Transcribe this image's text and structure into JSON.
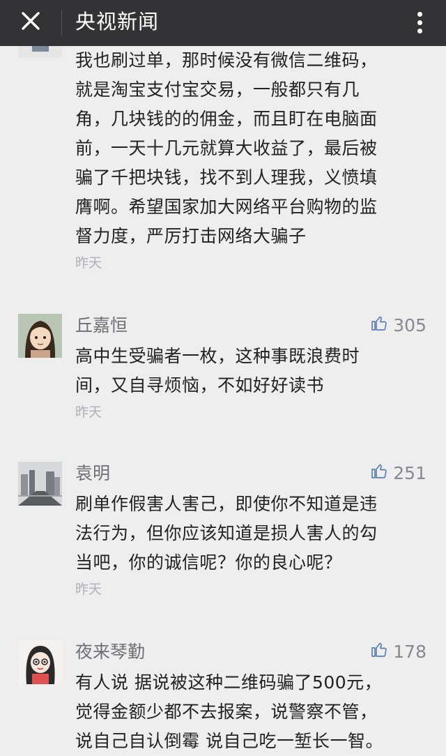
{
  "header": {
    "title": "央视新闻"
  },
  "comments": [
    {
      "username": "",
      "likes": "",
      "lines": [
        "我也刷过单，那时候没有微信二维码，",
        "就是淘宝支付宝交易，一般都只有几",
        "角，几块钱的的佣金，而且盯在电脑面",
        "前，一天十几元就算大收益了，最后被",
        "骗了千把块钱，找不到人理我，义愤填",
        "膺啊。希望国家加大网络平台购物的监",
        "督力度，严厉打击网络大骗子"
      ],
      "time": "昨天"
    },
    {
      "username": "丘嘉恒",
      "likes": "305",
      "lines": [
        "高中生受骗者一枚，这种事既浪费时",
        "间，又自寻烦恼，不如好好读书"
      ],
      "time": "昨天"
    },
    {
      "username": "袁明",
      "likes": "251",
      "lines": [
        "刷单作假害人害己，即使你不知道是违",
        "法行为，但你应该知道是损人害人的勾",
        "当吧，你的诚信呢？你的良心呢？"
      ],
      "time": "昨天"
    },
    {
      "username": "夜来琴勤",
      "likes": "178",
      "lines": [
        "有人说 据说被这种二维码骗了500元，",
        "觉得金额少都不去报案，说警察不管，",
        "说自己自认倒霉 说自己吃一堑长一智。"
      ],
      "time": ""
    }
  ],
  "icons": {
    "close": "close-icon",
    "more": "more-vertical-icon",
    "like": "thumbs-up-icon"
  },
  "colors": {
    "topbar": "#333336",
    "background": "#eeeeee",
    "like": "#5b7fb5"
  }
}
